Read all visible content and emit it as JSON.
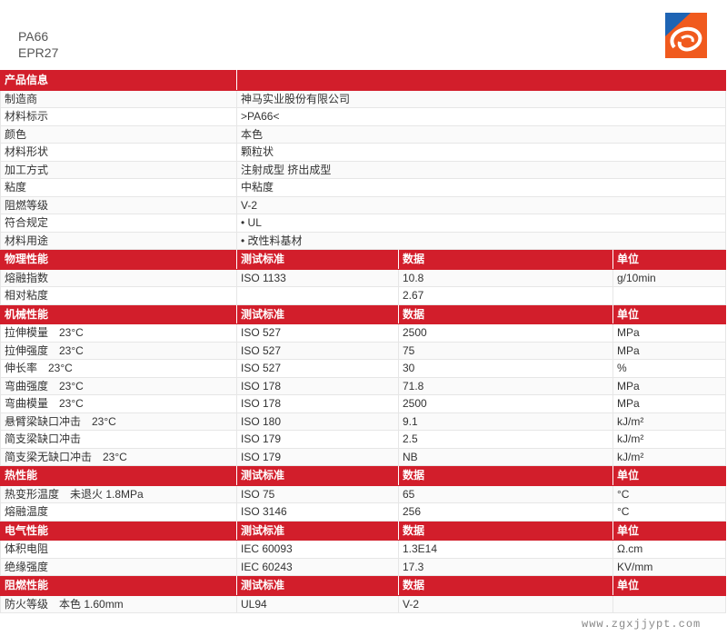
{
  "header": {
    "title_line1": "PA66",
    "title_line2": "EPR27"
  },
  "colors": {
    "section_bg": "#d21e2b",
    "logo_orange": "#f05a1e",
    "logo_blue": "#1e64b4"
  },
  "info_section": {
    "title": "产品信息",
    "rows": [
      [
        "制造商",
        "神马实业股份有限公司"
      ],
      [
        "材料标示",
        ">PA66<"
      ],
      [
        "颜色",
        "本色"
      ],
      [
        "材料形状",
        "颗粒状"
      ],
      [
        "加工方式",
        "注射成型 挤出成型"
      ],
      [
        "粘度",
        "中粘度"
      ],
      [
        "阻燃等级",
        "V-2"
      ],
      [
        "符合规定",
        "• UL"
      ],
      [
        "材料用途",
        "• 改性料基材"
      ]
    ]
  },
  "property_sections": [
    {
      "title": "物理性能",
      "col_standard": "测试标准",
      "col_value": "数据",
      "col_unit": "单位",
      "rows": [
        [
          "熔融指数",
          "ISO 1133",
          "10.8",
          "g/10min"
        ],
        [
          "相对粘度",
          "",
          "2.67",
          ""
        ]
      ]
    },
    {
      "title": "机械性能",
      "col_standard": "测试标准",
      "col_value": "数据",
      "col_unit": "单位",
      "rows": [
        [
          "拉伸模量　23°C",
          "ISO 527",
          "2500",
          "MPa"
        ],
        [
          "拉伸强度　23°C",
          "ISO 527",
          "75",
          "MPa"
        ],
        [
          "伸长率　23°C",
          "ISO 527",
          "30",
          "%"
        ],
        [
          "弯曲强度　23°C",
          "ISO 178",
          "71.8",
          "MPa"
        ],
        [
          "弯曲模量　23°C",
          "ISO 178",
          "2500",
          "MPa"
        ],
        [
          "悬臂梁缺口冲击　23°C",
          "ISO 180",
          "9.1",
          "kJ/m²"
        ],
        [
          "简支梁缺口冲击",
          "ISO 179",
          "2.5",
          "kJ/m²"
        ],
        [
          "简支梁无缺口冲击　23°C",
          "ISO 179",
          "NB",
          "kJ/m²"
        ]
      ]
    },
    {
      "title": "热性能",
      "col_standard": "测试标准",
      "col_value": "数据",
      "col_unit": "单位",
      "rows": [
        [
          "热变形温度　未退火 1.8MPa",
          "ISO 75",
          "65",
          "°C"
        ],
        [
          "熔融温度",
          "ISO 3146",
          "256",
          "°C"
        ]
      ]
    },
    {
      "title": "电气性能",
      "col_standard": "测试标准",
      "col_value": "数据",
      "col_unit": "单位",
      "rows": [
        [
          "体积电阻",
          "IEC 60093",
          "1.3E14",
          "Ω.cm"
        ],
        [
          "绝缘强度",
          "IEC 60243",
          "17.3",
          "KV/mm"
        ]
      ]
    },
    {
      "title": "阻燃性能",
      "col_standard": "测试标准",
      "col_value": "数据",
      "col_unit": "单位",
      "rows": [
        [
          "防火等级　本色 1.60mm",
          "UL94",
          "V-2",
          ""
        ]
      ]
    }
  ],
  "watermark": "www.zgxjjypt.com"
}
